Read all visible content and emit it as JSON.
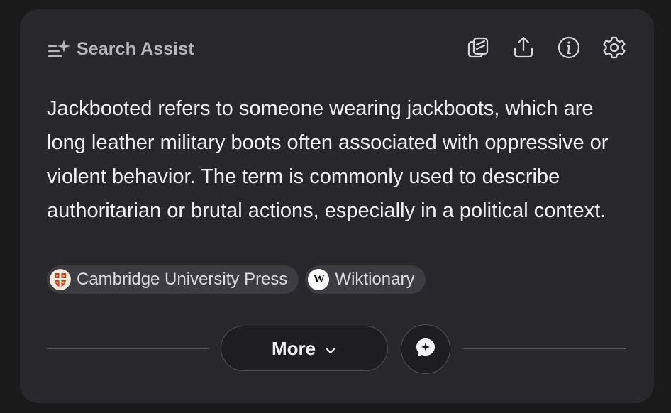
{
  "header": {
    "title": "Search Assist",
    "icons": [
      "sparkle-list-icon",
      "copy-icon",
      "share-icon",
      "info-icon",
      "gear-icon"
    ]
  },
  "answer": {
    "text": "Jackbooted refers to someone wearing jackboots, which are long leather military boots often associated with oppressive or violent behavior. The term is commonly used to describe authoritarian or brutal actions, especially in a political context."
  },
  "sources": [
    {
      "label": "Cambridge University Press",
      "icon": "cambridge-crest-icon"
    },
    {
      "label": "Wiktionary",
      "icon": "wiktionary-icon",
      "icon_text": "W"
    }
  ],
  "footer": {
    "more_label": "More",
    "more_icon": "chevron-down-icon",
    "chat_icon": "chat-sparkle-icon"
  },
  "colors": {
    "background": "#1a1a1b",
    "card": "#28282b",
    "chip": "#3d3d41",
    "text": "#f0f0f2",
    "muted": "#b6b6bb"
  }
}
